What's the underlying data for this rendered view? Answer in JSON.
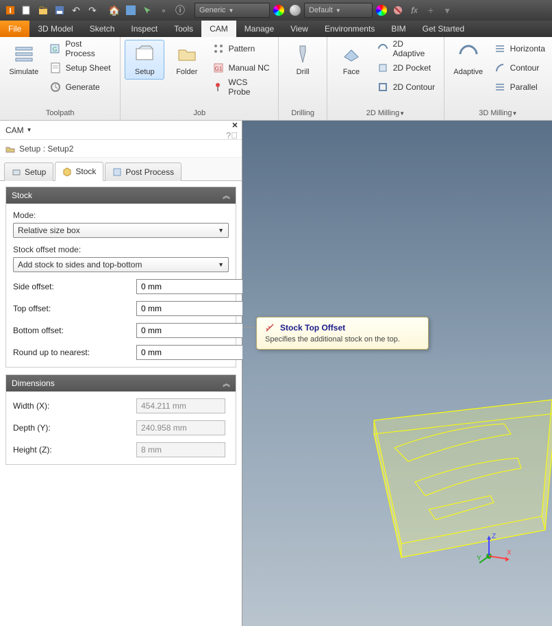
{
  "titlebar": {
    "material_dd": "Generic",
    "appearance_dd": "Default"
  },
  "menu": {
    "file": "File",
    "tabs": [
      "3D Model",
      "Sketch",
      "Inspect",
      "Tools",
      "CAM",
      "Manage",
      "View",
      "Environments",
      "BIM",
      "Get Started"
    ],
    "active": "CAM"
  },
  "ribbon": {
    "toolpath": {
      "label": "Toolpath",
      "simulate": "Simulate",
      "post_process": "Post Process",
      "setup_sheet": "Setup Sheet",
      "generate": "Generate"
    },
    "job": {
      "label": "Job",
      "setup": "Setup",
      "folder": "Folder",
      "pattern": "Pattern",
      "manual_nc": "Manual NC",
      "wcs_probe": "WCS Probe"
    },
    "drilling": {
      "label": "Drilling",
      "drill": "Drill"
    },
    "milling2d": {
      "label": "2D Milling",
      "face": "Face",
      "adaptive": "2D Adaptive",
      "pocket": "2D Pocket",
      "contour": "2D Contour"
    },
    "milling3d": {
      "label": "3D Milling",
      "adaptive": "Adaptive",
      "horizontal": "Horizonta",
      "contour": "Contour",
      "parallel": "Parallel"
    }
  },
  "panel": {
    "title": "CAM",
    "breadcrumb": "Setup : Setup2",
    "tabs": {
      "setup": "Setup",
      "stock": "Stock",
      "post": "Post Process"
    }
  },
  "stock": {
    "section_title": "Stock",
    "mode_label": "Mode:",
    "mode_value": "Relative size box",
    "offset_mode_label": "Stock offset mode:",
    "offset_mode_value": "Add stock to sides and top-bottom",
    "side_offset_label": "Side offset:",
    "side_offset_value": "0 mm",
    "top_offset_label": "Top offset:",
    "top_offset_value": "0 mm",
    "bottom_offset_label": "Bottom offset:",
    "bottom_offset_value": "0 mm",
    "round_label": "Round up to nearest:",
    "round_value": "0 mm"
  },
  "dimensions": {
    "section_title": "Dimensions",
    "width_label": "Width (X):",
    "width_value": "454.211 mm",
    "depth_label": "Depth (Y):",
    "depth_value": "240.958 mm",
    "height_label": "Height (Z):",
    "height_value": "8 mm"
  },
  "tooltip": {
    "title": "Stock Top Offset",
    "body": "Specifies the additional stock on the top."
  },
  "axes": {
    "x": "X",
    "y": "Y",
    "z": "Z"
  }
}
